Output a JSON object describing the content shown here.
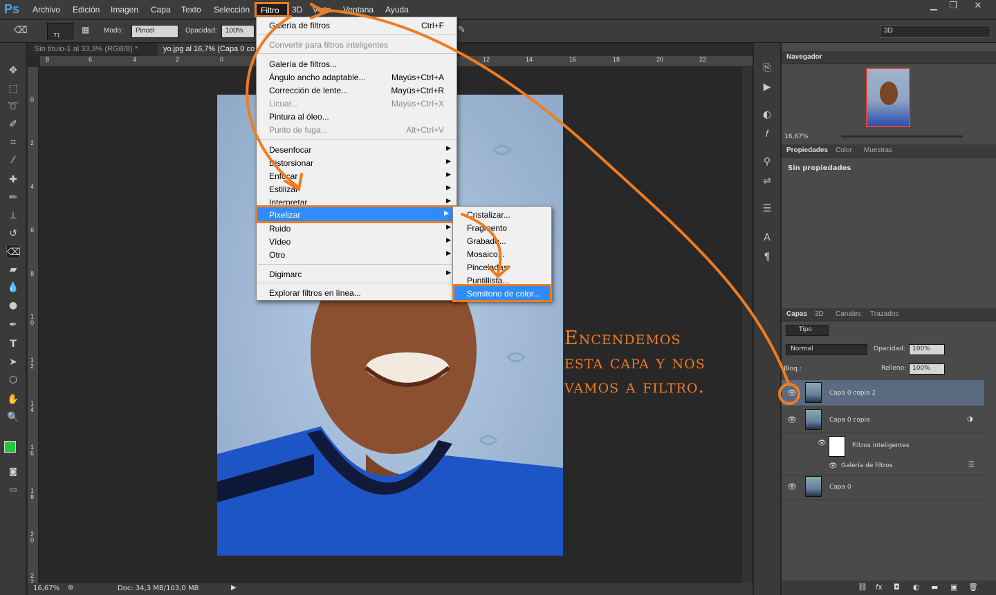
{
  "menubar": {
    "logo": "Ps",
    "items": [
      "Archivo",
      "Edición",
      "Imagen",
      "Capa",
      "Texto",
      "Selección",
      "Filtro",
      "3D",
      "Vista",
      "Ventana",
      "Ayuda"
    ]
  },
  "options": {
    "mode_label": "Modo:",
    "mode_value": "Pincel",
    "opacity_label": "Opacidad:",
    "opacity_value": "100%",
    "brush_size": "71",
    "workspace": "3D"
  },
  "tabs": {
    "doc1": "Sin título-1 al 33,3% (RGB/8) *",
    "doc2": "yo.jpg al 16,7% (Capa 0 co"
  },
  "ruler_top": [
    "8",
    "6",
    "4",
    "2",
    "0",
    "12",
    "14",
    "16",
    "18",
    "20",
    "22"
  ],
  "ruler_left": [
    "0",
    "2",
    "4",
    "6",
    "8",
    "1\n0",
    "1\n2",
    "1\n4",
    "1\n6",
    "1\n8",
    "2\n0",
    "2\n2"
  ],
  "status": {
    "zoom": "16,67%",
    "doc": "Doc: 34,3 MB/103,0 MB"
  },
  "filter_menu": {
    "last": "Galería de filtros",
    "last_shortcut": "Ctrl+F",
    "smart": "Convertir para filtros inteligentes",
    "gallery": "Galería de filtros...",
    "wide": "Ángulo ancho adaptable...",
    "wide_sc": "Mayús+Ctrl+A",
    "lens": "Corrección de lente...",
    "lens_sc": "Mayús+Ctrl+R",
    "liquify": "Licuar...",
    "liquify_sc": "Mayús+Ctrl+X",
    "oil": "Pintura al óleo...",
    "vanish": "Punto de fuga...",
    "vanish_sc": "Alt+Ctrl+V",
    "blur": "Desenfocar",
    "distort": "Distorsionar",
    "sharpen": "Enfocar",
    "stylize": "Estilizar",
    "render": "Interpretar",
    "pixelate": "Pixelizar",
    "noise": "Ruido",
    "video": "Vídeo",
    "other": "Otro",
    "digimarc": "Digimarc",
    "browse": "Explorar filtros en línea..."
  },
  "pixelate_menu": [
    "Cristalizar...",
    "Fragmento",
    "Grabado...",
    "Mosaico...",
    "Pinceladas",
    "Puntillista...",
    "Semitono de color..."
  ],
  "annotation": [
    "Encendemos",
    "esta capa y nos",
    "vamos a filtro."
  ],
  "navigator": {
    "title": "Navegador",
    "zoom": "16,67%"
  },
  "properties": {
    "tabs": [
      "Propiedades",
      "Color",
      "Muestras"
    ],
    "empty": "Sin propiedades"
  },
  "layers_panel": {
    "tabs": [
      "Capas",
      "3D",
      "Canales",
      "Trazados"
    ],
    "filter": "Tipo",
    "blend": "Normal",
    "opacity_label": "Opacidad:",
    "opacity": "100%",
    "lock_label": "Bloq.:",
    "fill_label": "Relleno:",
    "fill": "100%",
    "layers": [
      "Capa 0 copia 2",
      "Capa 0 copia",
      "Filtros inteligentes",
      "Galería de filtros",
      "Capa 0"
    ]
  }
}
